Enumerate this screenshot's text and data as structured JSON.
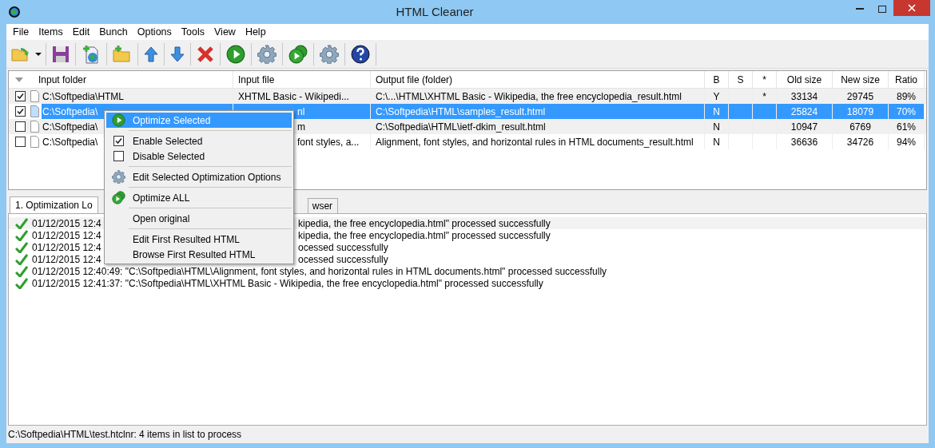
{
  "window": {
    "title": "HTML Cleaner"
  },
  "menu_bar": [
    "File",
    "Items",
    "Edit",
    "Bunch",
    "Options",
    "Tools",
    "View",
    "Help"
  ],
  "table": {
    "columns": [
      "Input folder",
      "Input file",
      "Output file (folder)",
      "B",
      "S",
      "*",
      "Old size",
      "New size",
      "Ratio"
    ],
    "rows": [
      {
        "checked": true,
        "selected": false,
        "folder": "C:\\Softpedia\\HTML",
        "input_file": "XHTML Basic - Wikipedi...",
        "output": "C:\\...\\HTML\\XHTML Basic - Wikipedia, the free encyclopedia_result.html",
        "b": "Y",
        "s": "",
        "star": "*",
        "old": "33134",
        "new": "29745",
        "ratio": "89%"
      },
      {
        "checked": true,
        "selected": true,
        "folder": "C:\\Softpedia\\",
        "input_file_tail": "nl",
        "output": "C:\\Softpedia\\HTML\\samples_result.html",
        "b": "N",
        "s": "",
        "star": "",
        "old": "25824",
        "new": "18079",
        "ratio": "70%"
      },
      {
        "checked": false,
        "selected": false,
        "folder": "C:\\Softpedia\\",
        "input_file_tail": "m",
        "output": "C:\\Softpedia\\HTML\\ietf-dkim_result.html",
        "b": "N",
        "s": "",
        "star": "",
        "old": "10947",
        "new": "6769",
        "ratio": "61%"
      },
      {
        "checked": false,
        "selected": false,
        "folder": "C:\\Softpedia\\",
        "input_file_tail": "font styles, a...",
        "output": "Alignment, font styles, and horizontal rules in HTML documents_result.html",
        "b": "N",
        "s": "",
        "star": "",
        "old": "36636",
        "new": "34726",
        "ratio": "94%"
      }
    ]
  },
  "tabs": [
    {
      "label": "1. Optimization Lo",
      "selected": true
    },
    {
      "label": "wser",
      "selected": false
    }
  ],
  "log": [
    {
      "text": "01/12/2015 12:4",
      "tail": "kipedia, the free encyclopedia.html\" processed successfully"
    },
    {
      "text": "01/12/2015 12:4",
      "tail": "kipedia, the free encyclopedia.html\" processed successfully"
    },
    {
      "text": "01/12/2015 12:4",
      "tail": "ocessed successfully"
    },
    {
      "text": "01/12/2015 12:4",
      "tail": "ocessed successfully"
    },
    {
      "text": "01/12/2015 12:40:49: \"C:\\Softpedia\\HTML\\Alignment, font styles, and horizontal rules in HTML documents.html\" processed successfully"
    },
    {
      "text": "01/12/2015 12:41:37: \"C:\\Softpedia\\HTML\\XHTML Basic - Wikipedia, the free encyclopedia.html\" processed successfully"
    }
  ],
  "context_menu": {
    "items": [
      {
        "kind": "play",
        "label": "Optimize Selected",
        "selected": true
      },
      {
        "kind": "separator"
      },
      {
        "kind": "check",
        "label": "Enable Selected",
        "checked": true,
        "selected": false
      },
      {
        "kind": "check",
        "label": "Disable Selected",
        "checked": false,
        "selected": false
      },
      {
        "kind": "separator"
      },
      {
        "kind": "gear",
        "label": "Edit Selected Optimization Options",
        "selected": false
      },
      {
        "kind": "separator"
      },
      {
        "kind": "play-all",
        "label": "Optimize ALL",
        "selected": false
      },
      {
        "kind": "separator"
      },
      {
        "kind": "item",
        "label": "Open original",
        "selected": false
      },
      {
        "kind": "separator"
      },
      {
        "kind": "item",
        "label": "Edit First Resulted HTML",
        "selected": false
      },
      {
        "kind": "item",
        "label": "Browse First Resulted HTML",
        "selected": false
      }
    ]
  },
  "status_bar": "C:\\Softpedia\\HTML\\test.htclnr: 4 items in list to process"
}
